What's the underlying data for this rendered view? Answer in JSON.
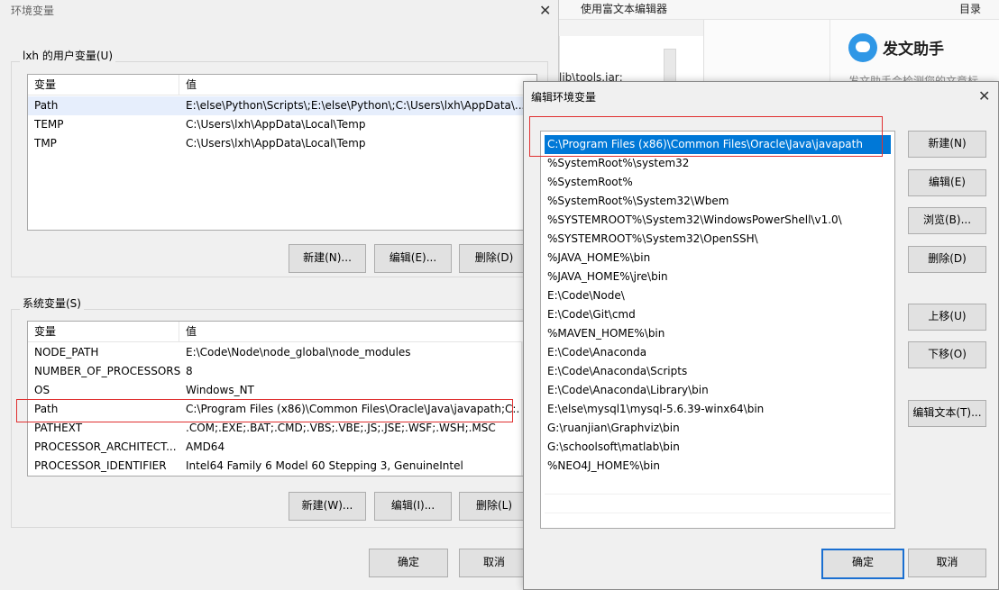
{
  "background": {
    "code_fragment": "lib\\tools.jar;",
    "toolbar_link": "使用富文本编辑器",
    "toolbar_menu": "目录",
    "assistant_title": "发文助手",
    "assistant_sub": "发文助手会检测您的文章标"
  },
  "env_dialog": {
    "title": "环境变量",
    "user_group_label": "lxh 的用户变量(U)",
    "columns": {
      "var": "变量",
      "val": "值"
    },
    "user_vars": [
      {
        "name": "Path",
        "value": "E:\\else\\Python\\Scripts\\;E:\\else\\Python\\;C:\\Users\\lxh\\AppData\\..."
      },
      {
        "name": "TEMP",
        "value": "C:\\Users\\lxh\\AppData\\Local\\Temp"
      },
      {
        "name": "TMP",
        "value": "C:\\Users\\lxh\\AppData\\Local\\Temp"
      }
    ],
    "user_buttons": {
      "new": "新建(N)...",
      "edit": "编辑(E)...",
      "delete": "删除(D)"
    },
    "sys_group_label": "系统变量(S)",
    "sys_vars": [
      {
        "name": "NODE_PATH",
        "value": "E:\\Code\\Node\\node_global\\node_modules"
      },
      {
        "name": "NUMBER_OF_PROCESSORS",
        "value": "8"
      },
      {
        "name": "OS",
        "value": "Windows_NT"
      },
      {
        "name": "Path",
        "value": "C:\\Program Files (x86)\\Common Files\\Oracle\\Java\\javapath;C:..."
      },
      {
        "name": "PATHEXT",
        "value": ".COM;.EXE;.BAT;.CMD;.VBS;.VBE;.JS;.JSE;.WSF;.WSH;.MSC"
      },
      {
        "name": "PROCESSOR_ARCHITECT...",
        "value": "AMD64"
      },
      {
        "name": "PROCESSOR_IDENTIFIER",
        "value": "Intel64 Family 6 Model 60 Stepping 3, GenuineIntel"
      }
    ],
    "sys_buttons": {
      "new": "新建(W)...",
      "edit": "编辑(I)...",
      "delete": "删除(L)"
    },
    "ok": "确定",
    "cancel": "取消"
  },
  "edit_dialog": {
    "title": "编辑环境变量",
    "entries": [
      "C:\\Program Files (x86)\\Common Files\\Oracle\\Java\\javapath",
      "%SystemRoot%\\system32",
      "%SystemRoot%",
      "%SystemRoot%\\System32\\Wbem",
      "%SYSTEMROOT%\\System32\\WindowsPowerShell\\v1.0\\",
      "%SYSTEMROOT%\\System32\\OpenSSH\\",
      "%JAVA_HOME%\\bin",
      "%JAVA_HOME%\\jre\\bin",
      "E:\\Code\\Node\\",
      "E:\\Code\\Git\\cmd",
      "%MAVEN_HOME%\\bin",
      "E:\\Code\\Anaconda",
      "E:\\Code\\Anaconda\\Scripts",
      "E:\\Code\\Anaconda\\Library\\bin",
      "E:\\else\\mysql1\\mysql-5.6.39-winx64\\bin",
      "G:\\ruanjian\\Graphviz\\bin",
      "G:\\schoolsoft\\matlab\\bin",
      "%NEO4J_HOME%\\bin"
    ],
    "buttons": {
      "new": "新建(N)",
      "edit": "编辑(E)",
      "browse": "浏览(B)...",
      "delete": "删除(D)",
      "up": "上移(U)",
      "down": "下移(O)",
      "edit_text": "编辑文本(T)..."
    },
    "ok": "确定",
    "cancel": "取消"
  },
  "colors": {
    "selection": "#0078d7",
    "highlight_box": "#e03030"
  }
}
